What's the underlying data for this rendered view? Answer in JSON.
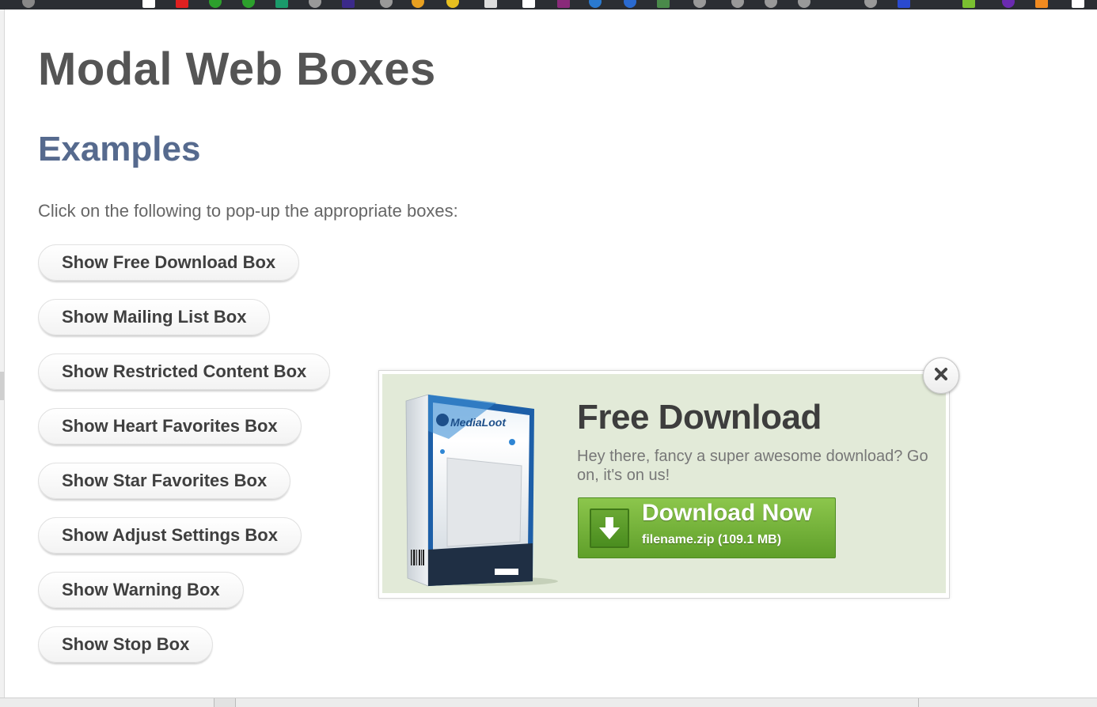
{
  "page": {
    "title": "Modal Web Boxes",
    "section_title": "Examples",
    "intro": "Click on the following to pop-up the appropriate boxes:"
  },
  "buttons": [
    {
      "label": "Show Free Download Box"
    },
    {
      "label": "Show Mailing List Box"
    },
    {
      "label": "Show Restricted Content Box"
    },
    {
      "label": "Show Heart Favorites Box"
    },
    {
      "label": "Show Star Favorites Box"
    },
    {
      "label": "Show Adjust Settings Box"
    },
    {
      "label": "Show Warning Box"
    },
    {
      "label": "Show Stop Box"
    }
  ],
  "modal": {
    "title": "Free Download",
    "text": "Hey there, fancy a super awesome download? Go on, it's on us!",
    "download_label": "Download Now",
    "file_info": "filename.zip (109.1 MB)",
    "product_brand": "MediaLoot",
    "close_icon": "close-icon",
    "download_icon": "arrow-down-icon"
  },
  "colors": {
    "heading": "#555555",
    "section_heading": "#566a8e",
    "modal_background": "#e2ead8",
    "download_button": "#6fb03a"
  }
}
